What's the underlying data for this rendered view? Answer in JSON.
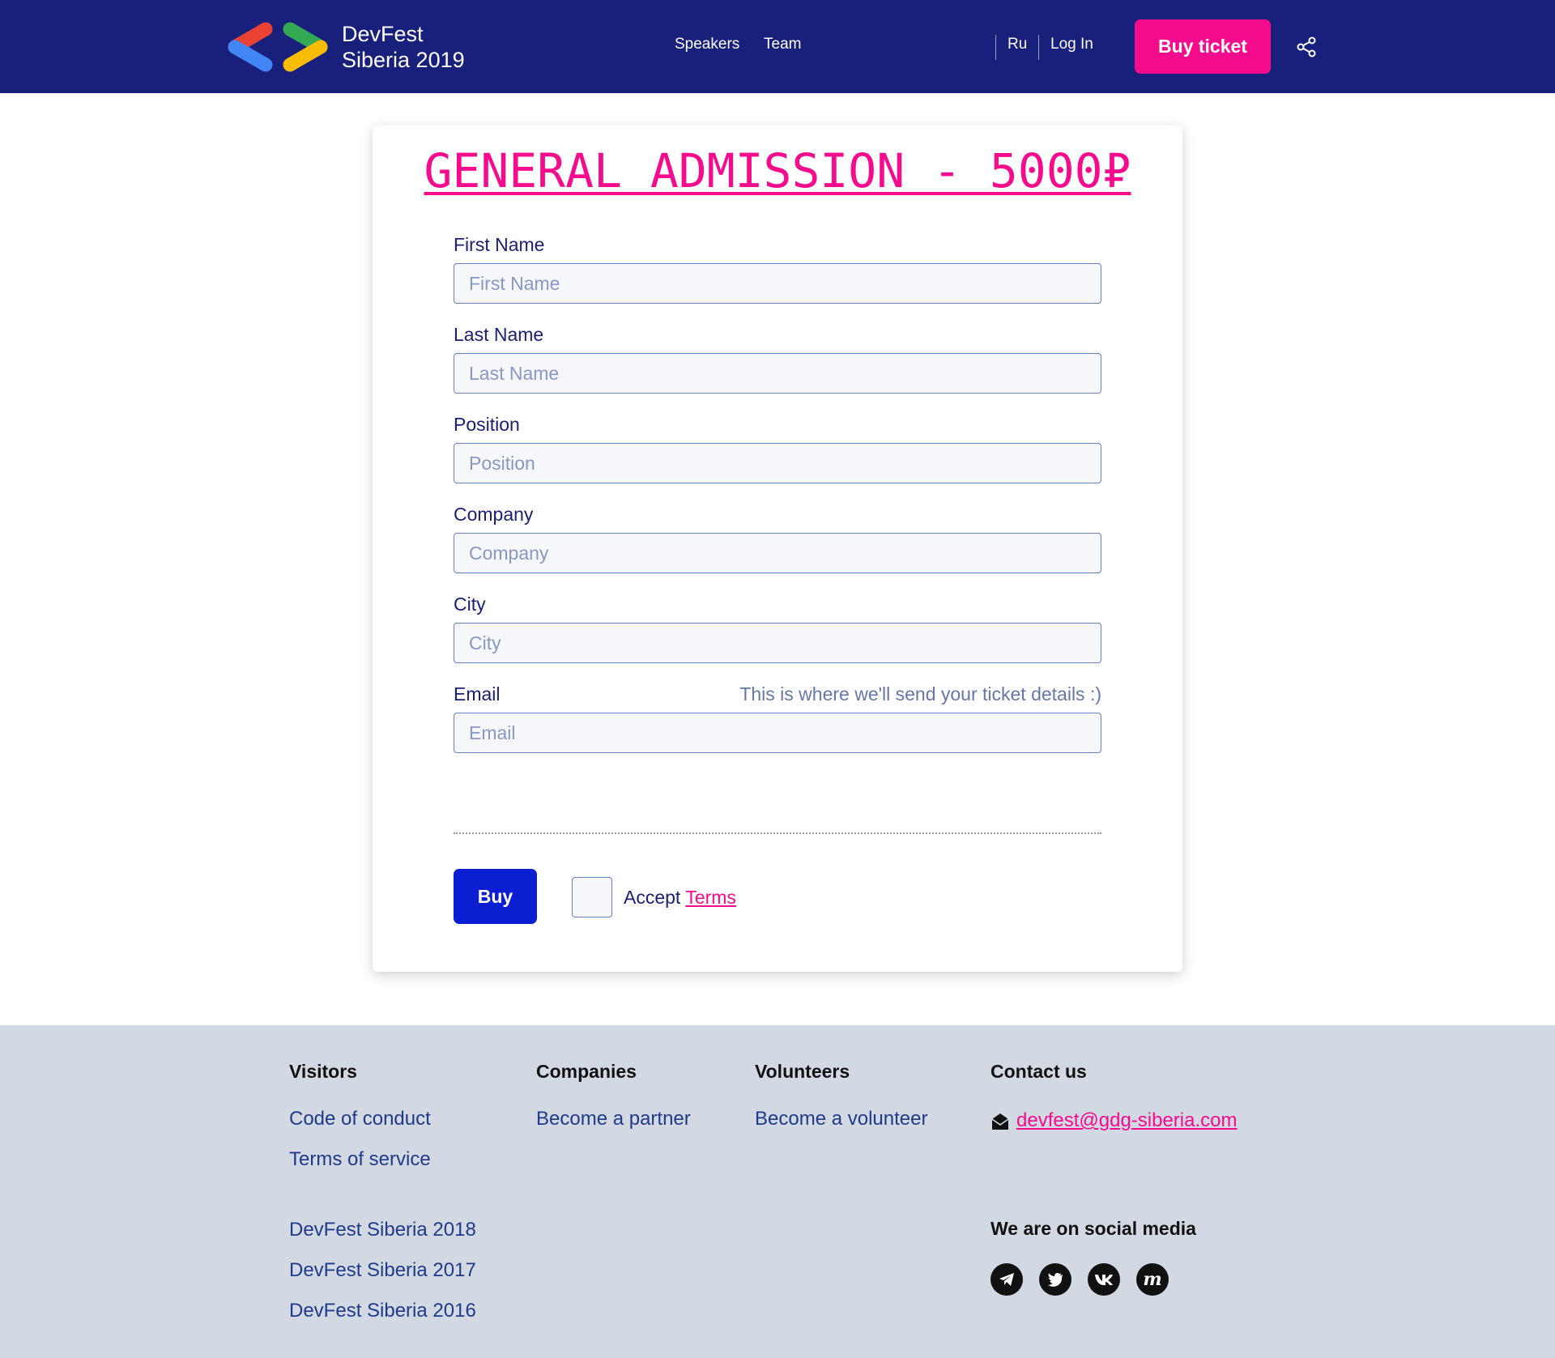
{
  "header": {
    "logo_line1": "DevFest",
    "logo_line2": "Siberia 2019",
    "nav": [
      "Speakers",
      "Team"
    ],
    "lang": "Ru",
    "login": "Log In",
    "buy_ticket": "Buy ticket",
    "icons": {
      "share": "share-icon",
      "logo": "devfest-logo-icon"
    }
  },
  "form": {
    "title": "GENERAL ADMISSION - 5000₽",
    "fields": [
      {
        "label": "First Name",
        "placeholder": "First Name",
        "value": ""
      },
      {
        "label": "Last Name",
        "placeholder": "Last Name",
        "value": ""
      },
      {
        "label": "Position",
        "placeholder": "Position",
        "value": ""
      },
      {
        "label": "Company",
        "placeholder": "Company",
        "value": ""
      },
      {
        "label": "City",
        "placeholder": "City",
        "value": ""
      },
      {
        "label": "Email",
        "placeholder": "Email",
        "value": "",
        "hint": "This is where we'll send your ticket details :)"
      }
    ],
    "buy": "Buy",
    "accept": "Accept",
    "terms": "Terms",
    "terms_checked": false
  },
  "footer": {
    "visitors": {
      "heading": "Visitors",
      "links": [
        "Code of conduct",
        "Terms of service"
      ]
    },
    "past_events": [
      "DevFest Siberia 2018",
      "DevFest Siberia 2017",
      "DevFest Siberia 2016"
    ],
    "companies": {
      "heading": "Companies",
      "links": [
        "Become a partner"
      ]
    },
    "volunteers": {
      "heading": "Volunteers",
      "links": [
        "Become a volunteer"
      ]
    },
    "contact": {
      "heading": "Contact us",
      "email": "devfest@gdg-siberia.com"
    },
    "social": {
      "heading": "We are on social media",
      "icons": [
        "telegram-icon",
        "twitter-icon",
        "vk-icon",
        "meetup-icon"
      ]
    }
  },
  "colors": {
    "header_bg": "#19207c",
    "accent": "#f50c8c",
    "buy_button": "#0b1ed2",
    "footer_bg": "#d3d9e3"
  }
}
